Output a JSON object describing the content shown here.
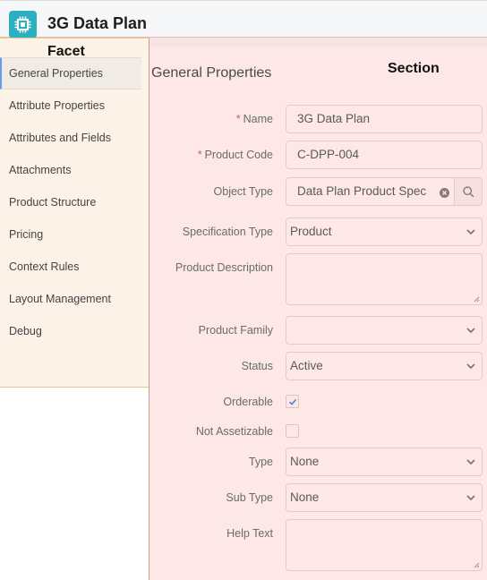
{
  "header": {
    "title": "3G Data Plan",
    "icon": "chip-icon"
  },
  "annotations": {
    "facet": "Facet",
    "section": "Section"
  },
  "facet": {
    "active_index": 0,
    "items": [
      {
        "label": "General Properties"
      },
      {
        "label": "Attribute Properties"
      },
      {
        "label": "Attributes and Fields"
      },
      {
        "label": "Attachments"
      },
      {
        "label": "Product Structure"
      },
      {
        "label": "Pricing"
      },
      {
        "label": "Context Rules"
      },
      {
        "label": "Layout Management"
      },
      {
        "label": "Debug"
      }
    ]
  },
  "section": {
    "title": "General Properties",
    "fields": {
      "name": {
        "label": "Name",
        "required": true,
        "required_marker": "*",
        "value": "3G Data Plan"
      },
      "product_code": {
        "label": "Product Code",
        "required": true,
        "required_marker": "*",
        "value": "C-DPP-004"
      },
      "object_type": {
        "label": "Object Type",
        "value": "Data Plan Product Spec",
        "clear_icon": "clear-icon",
        "search_icon": "search-icon"
      },
      "specification_type": {
        "label": "Specification Type",
        "value": "Product"
      },
      "product_description": {
        "label": "Product Description",
        "value": ""
      },
      "product_family": {
        "label": "Product Family",
        "value": ""
      },
      "status": {
        "label": "Status",
        "value": "Active"
      },
      "orderable": {
        "label": "Orderable",
        "checked": true
      },
      "not_assetizable": {
        "label": "Not Assetizable",
        "checked": false
      },
      "type": {
        "label": "Type",
        "value": "None"
      },
      "sub_type": {
        "label": "Sub Type",
        "value": "None"
      },
      "help_text": {
        "label": "Help Text",
        "value": ""
      }
    }
  },
  "colors": {
    "app_icon": "#2bb0c2",
    "facet_bg": "#fdf2e8",
    "section_bg": "#fde7e7",
    "active_accent": "#6a9ee0",
    "required": "#d06060",
    "checkmark": "#4a7fd4"
  }
}
